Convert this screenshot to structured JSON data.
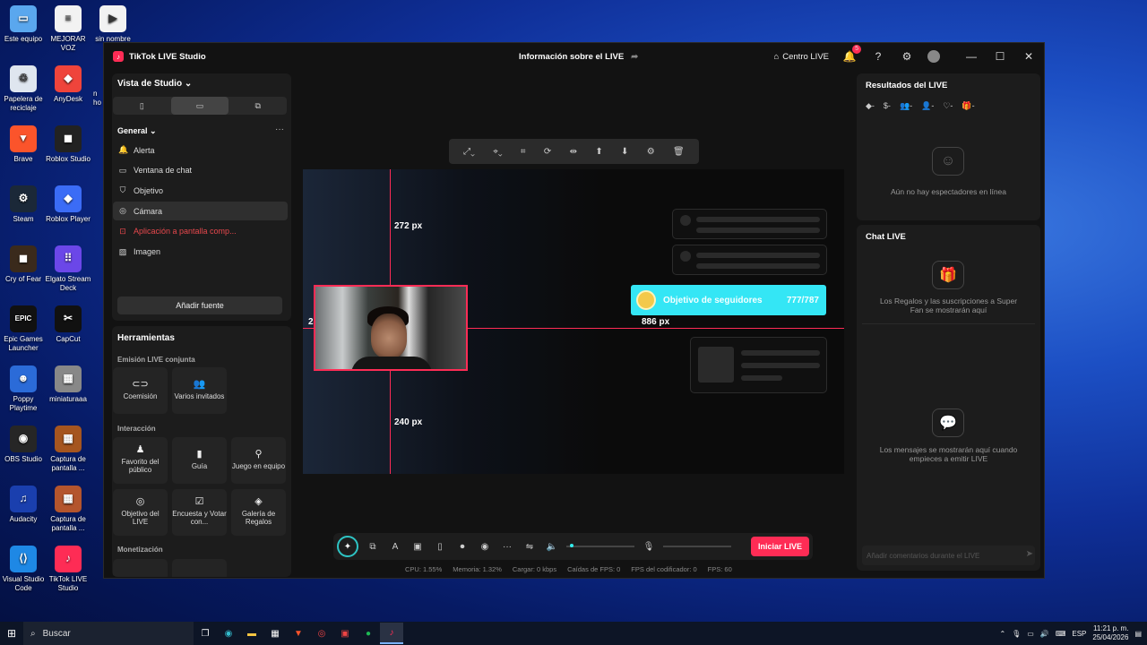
{
  "desktop": {
    "icons": [
      {
        "label": "Este equipo",
        "icon": "pc-icon",
        "color": "#5aa7ee",
        "glyph": "▭"
      },
      {
        "label": "MEJORAR VOZ",
        "icon": "document-icon",
        "color": "#f2f2f2",
        "glyph": "≡"
      },
      {
        "label": "sin nombre",
        "icon": "video-file-icon",
        "color": "#f2f2f2",
        "glyph": "▶"
      },
      {
        "label": "Papelera de reciclaje",
        "icon": "recycle-bin-icon",
        "color": "#dfe6ef",
        "glyph": "♲"
      },
      {
        "label": "AnyDesk",
        "icon": "anydesk-icon",
        "color": "#ef443b",
        "glyph": "◆"
      },
      {
        "label": "Brave",
        "icon": "brave-icon",
        "color": "#fb542b",
        "glyph": "▼"
      },
      {
        "label": "Roblox Studio",
        "icon": "roblox-studio-icon",
        "color": "#222222",
        "glyph": "◼"
      },
      {
        "label": "Steam",
        "icon": "steam-icon",
        "color": "#1b2838",
        "glyph": "⚙"
      },
      {
        "label": "Roblox Player",
        "icon": "roblox-icon",
        "color": "#3b6cf6",
        "glyph": "◆"
      },
      {
        "label": "Cry of Fear",
        "icon": "cry-of-fear-icon",
        "color": "#3a2a1c",
        "glyph": "◼"
      },
      {
        "label": "Elgato Stream Deck",
        "icon": "stream-deck-icon",
        "color": "#6b47e8",
        "glyph": "⠿"
      },
      {
        "label": "Epic Games Launcher",
        "icon": "epic-games-icon",
        "color": "#111111",
        "glyph": "EPIC"
      },
      {
        "label": "CapCut",
        "icon": "capcut-icon",
        "color": "#111111",
        "glyph": "✂"
      },
      {
        "label": "Poppy Playtime",
        "icon": "poppy-playtime-icon",
        "color": "#2b6bd8",
        "glyph": "☻"
      },
      {
        "label": "miniaturaaa",
        "icon": "image-file-icon",
        "color": "#888888",
        "glyph": "▦"
      },
      {
        "label": "OBS Studio",
        "icon": "obs-icon",
        "color": "#262626",
        "glyph": "◉"
      },
      {
        "label": "Captura de pantalla ...",
        "icon": "screenshot-file-icon",
        "color": "#a5551f",
        "glyph": "▦"
      },
      {
        "label": "Audacity",
        "icon": "audacity-icon",
        "color": "#1a3fae",
        "glyph": "♫"
      },
      {
        "label": "Captura de pantalla ...",
        "icon": "screenshot-file-icon",
        "color": "#b4552d",
        "glyph": "▦"
      },
      {
        "label": "Visual Studio Code",
        "icon": "vscode-icon",
        "color": "#1e88e5",
        "glyph": "⟨⟩"
      },
      {
        "label": "TikTok LIVE Studio",
        "icon": "tiktok-live-studio-icon",
        "color": "#fe2c55",
        "glyph": "♪"
      }
    ],
    "partial_labels": [
      "n",
      "ho"
    ]
  },
  "app": {
    "title": "TikTok LIVE Studio",
    "center_title": "Información sobre el LIVE",
    "centro_live": "Centro LIVE",
    "notif_count": "5"
  },
  "sources": {
    "vista": "Vista de Studio",
    "group": "General",
    "items": [
      {
        "label": "Alerta",
        "icon": "bell-icon",
        "glyph": "🔔"
      },
      {
        "label": "Ventana de chat",
        "icon": "chat-icon",
        "glyph": "▭"
      },
      {
        "label": "Objetivo",
        "icon": "shield-icon",
        "glyph": "⛉"
      },
      {
        "label": "Cámara",
        "icon": "camera-icon",
        "glyph": "◎"
      },
      {
        "label": "Aplicación a pantalla comp...",
        "icon": "fullscreen-app-icon",
        "glyph": "⊡"
      },
      {
        "label": "Imagen",
        "icon": "image-icon",
        "glyph": "▨"
      }
    ],
    "add": "Añadir fuente"
  },
  "tools": {
    "title": "Herramientas",
    "sections": [
      "Emisión LIVE conjunta",
      "Interacción",
      "Monetización"
    ],
    "cohost": [
      {
        "label": "Coemisión",
        "icon": "link-icon",
        "glyph": "⊂⊃"
      },
      {
        "label": "Varios invitados",
        "icon": "guests-icon",
        "glyph": "👥"
      }
    ],
    "interaction": [
      {
        "label": "Favorito del público",
        "icon": "favorite-icon",
        "glyph": "♟"
      },
      {
        "label": "Guía",
        "icon": "guide-icon",
        "glyph": "▮"
      },
      {
        "label": "Juego en equipo",
        "icon": "team-game-icon",
        "glyph": "⚲"
      },
      {
        "label": "Objetivo del LIVE",
        "icon": "target-icon",
        "glyph": "◎"
      },
      {
        "label": "Encuesta y Votar con...",
        "icon": "poll-icon",
        "glyph": "☑"
      },
      {
        "label": "Galería de Regalos",
        "icon": "gift-gallery-icon",
        "glyph": "◈"
      }
    ]
  },
  "canvas": {
    "dim_top": "272 px",
    "dim_left": "25 px",
    "dim_right": "886 px",
    "dim_bottom": "240 px",
    "goal_label": "Objetivo de seguidores",
    "goal_value": "777/787"
  },
  "controls": {
    "go_live": "Iniciar LIVE",
    "volume": 0.05
  },
  "stats": {
    "cpu": "CPU: 1.55%",
    "mem": "Memoria: 1.32%",
    "load": "Cargar: 0 kbps",
    "fps_drops": "Caídas de FPS: 0",
    "enc_fps": "FPS del codificador: 0",
    "fps": "FPS: 60"
  },
  "right": {
    "results_title": "Resultados del LIVE",
    "no_viewers": "Aún no hay espectadores en línea",
    "chat_title": "Chat LIVE",
    "gifts_msg": "Los Regalos y las suscripciones a Super Fan se mostrarán aquí",
    "messages_msg": "Los mensajes se mostrarán aquí cuando empieces a emitir LIVE",
    "comment_placeholder": "Añadir comentarios durante el LIVE"
  },
  "taskbar": {
    "search": "Buscar",
    "lang": "ESP",
    "time": "11:21 p. m.",
    "date": "25/04/2026"
  }
}
